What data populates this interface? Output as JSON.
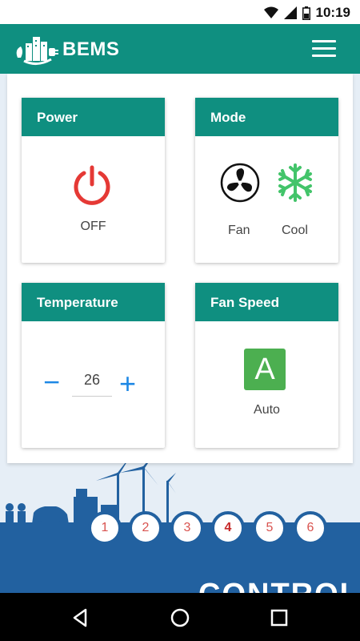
{
  "status_bar": {
    "time": "10:19"
  },
  "app_bar": {
    "title": "BEMS"
  },
  "cards": {
    "power": {
      "title": "Power",
      "state": "OFF"
    },
    "mode": {
      "title": "Mode",
      "options": [
        "Fan",
        "Cool"
      ]
    },
    "temperature": {
      "title": "Temperature",
      "minus": "−",
      "value": "26",
      "plus": "+"
    },
    "fan_speed": {
      "title": "Fan Speed",
      "badge": "A",
      "label": "Auto"
    }
  },
  "pagination": {
    "pages": [
      "1",
      "2",
      "3",
      "4",
      "5",
      "6"
    ],
    "active": "4"
  },
  "banner": {
    "text": "CONTROL"
  },
  "colors": {
    "primary": "#0f8f80",
    "power_off": "#e53935",
    "cool": "#43c46a",
    "accent_blue": "#1e88e5",
    "auto_badge": "#4caf50",
    "band": "#2261a0"
  }
}
